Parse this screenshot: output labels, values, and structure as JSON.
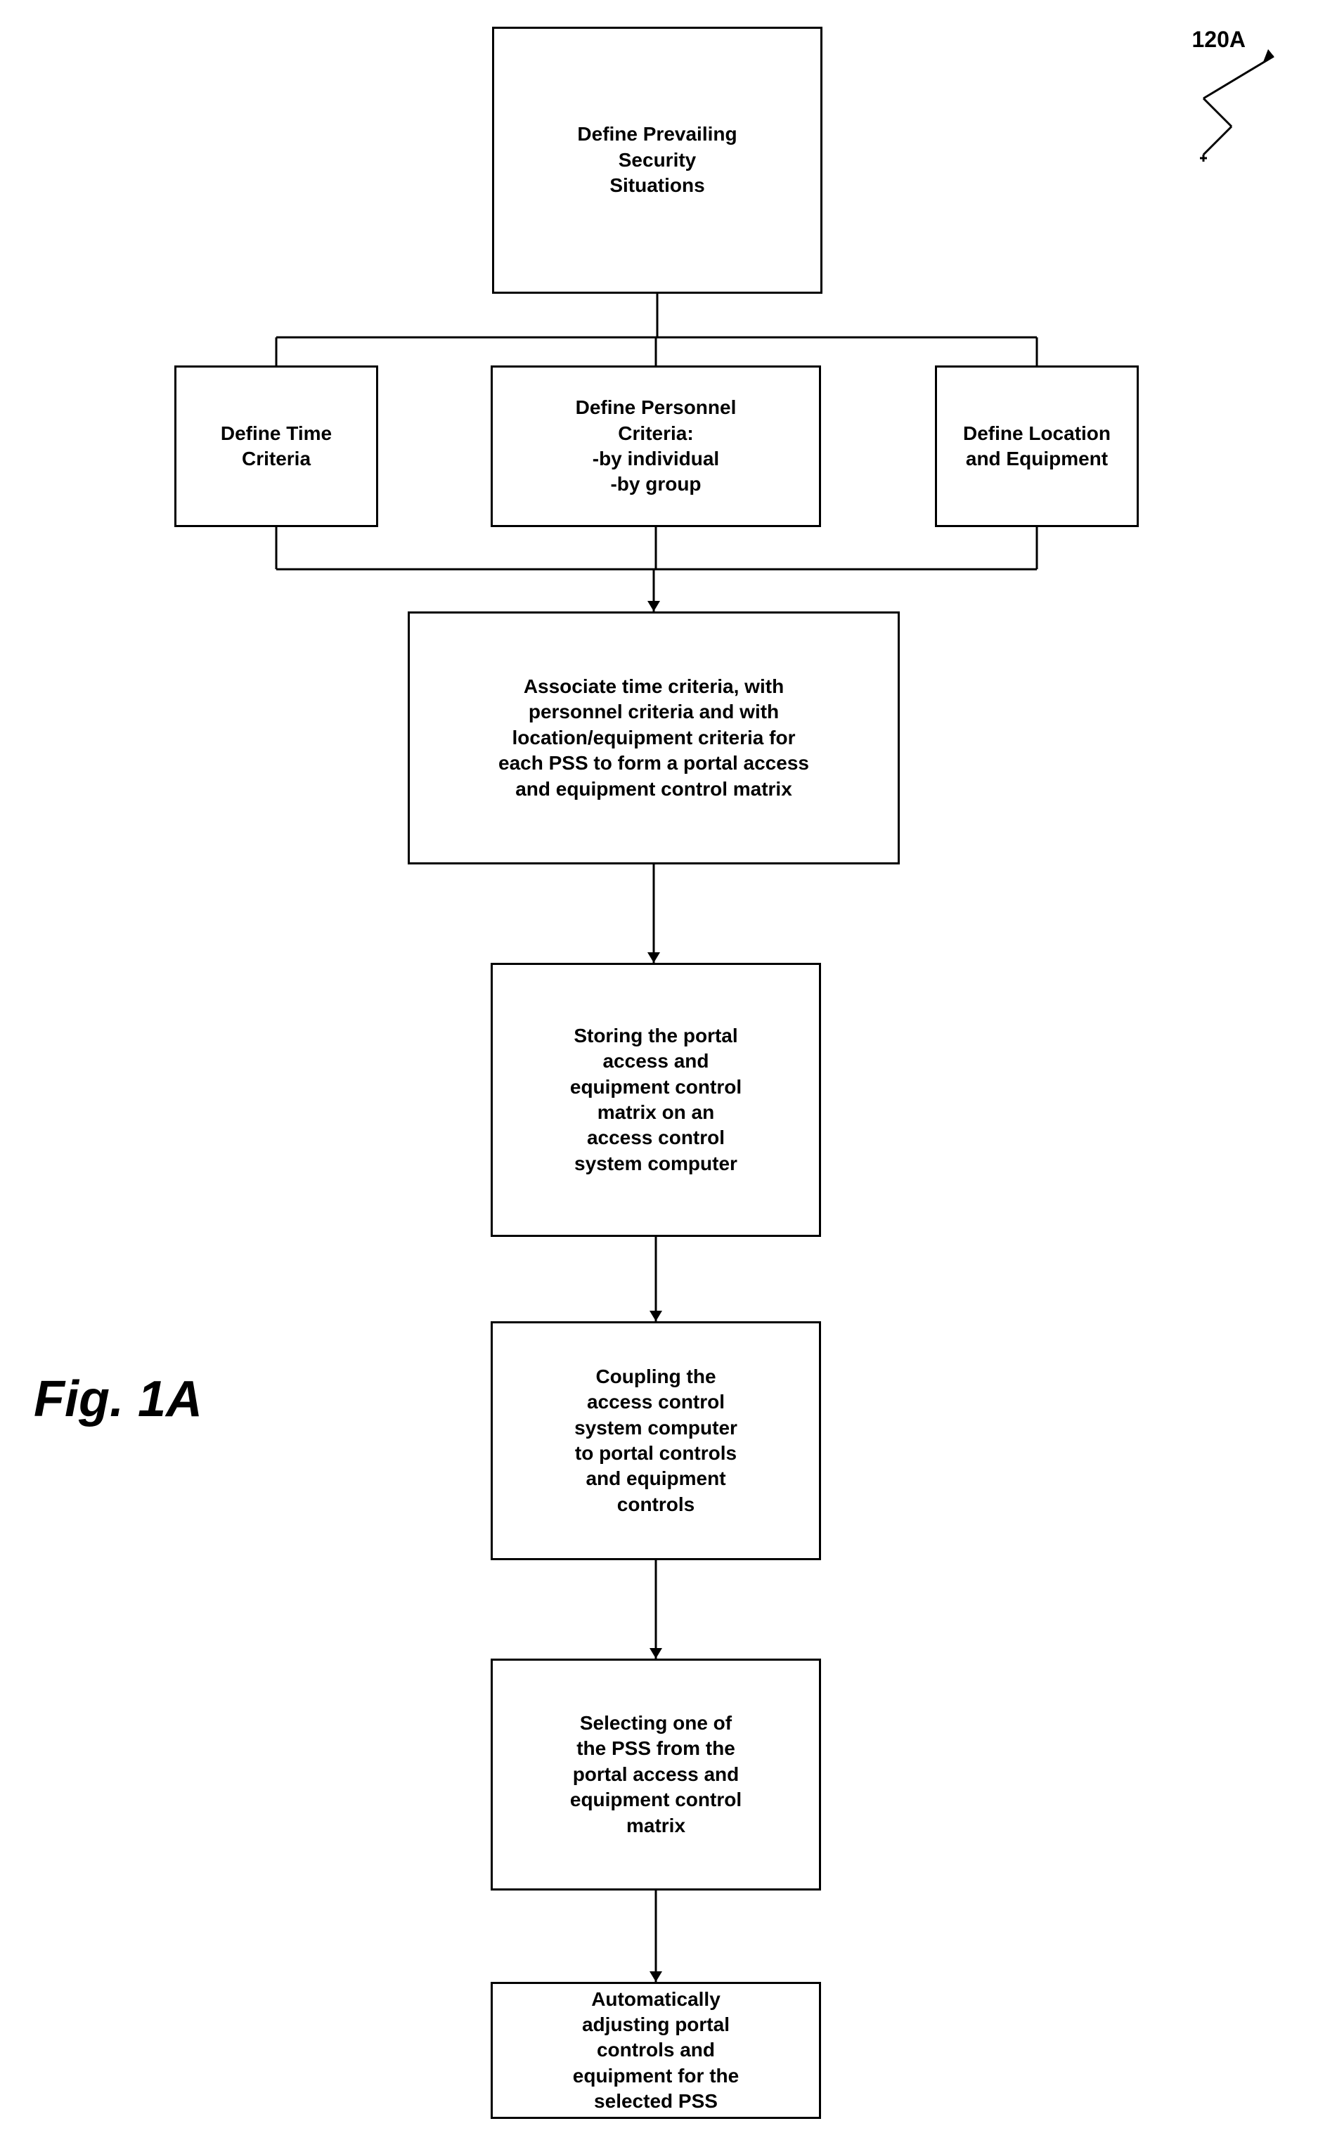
{
  "diagram": {
    "title": "Fig. 1A",
    "ref_number": "120A",
    "boxes": {
      "top": "Define Prevailing\nSecurity\nSituations",
      "left": "Define Time\nCriteria",
      "center": "Define Personnel\nCriteria:\n-by individual\n-by group",
      "right": "Define Location\nand Equipment",
      "associate": "Associate time criteria, with\npersonnel criteria and with\nlocation/equipment criteria for\neach PSS to form a portal access\nand equipment control matrix",
      "storing": "Storing the portal\naccess and\nequipment control\nmatrix on an\naccess control\nsystem computer",
      "coupling": "Coupling the\naccess control\nsystem computer\nto portal controls\nand equipment\ncontrols",
      "selecting": "Selecting one of\nthe PSS from the\nportal access and\nequipment control\nmatrix",
      "adjusting": "Automatically\nadjusting portal\ncontrols and\nequipment for the\nselected PSS"
    }
  }
}
